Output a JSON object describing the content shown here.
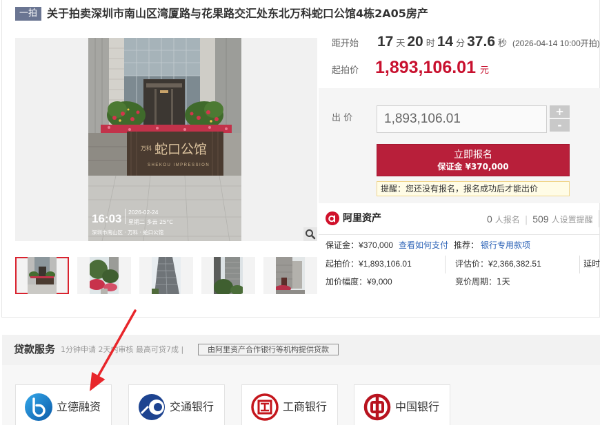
{
  "header": {
    "badge": "一拍",
    "title": "关于拍卖深圳市南山区湾厦路与花果路交汇处东北万科蛇口公馆4栋2A05房产"
  },
  "gallery": {
    "photo": {
      "sign_brand": "万科",
      "sign_name": "蛇口公馆",
      "sign_en": "SHEKOU IMPRESSION",
      "stamp_time": "16:03",
      "stamp_date": "2026-02-24",
      "stamp_weather": "星期二  多云 25°C",
      "stamp_location": "深圳市南山区 · 万科 · 蛇口公馆"
    },
    "zoom_icon": "magnifier-icon",
    "thumbnails": [
      {
        "selected": true
      },
      {
        "selected": false
      },
      {
        "selected": false
      },
      {
        "selected": false
      },
      {
        "selected": false
      }
    ]
  },
  "auction": {
    "countdown_label": "距开始",
    "countdown": {
      "days": "17",
      "days_unit": "天",
      "hours": "20",
      "hours_unit": "时",
      "minutes": "14",
      "minutes_unit": "分",
      "seconds": "37.6",
      "seconds_unit": "秒",
      "start_time_note": "(2026-04-14 10:00开拍)"
    },
    "start_price_label": "起拍价",
    "start_price": "1,893,106.01",
    "price_unit": "元",
    "bid": {
      "label": "出 价",
      "value": "1,893,106.01",
      "increment_label": "+",
      "decrement_label": "-"
    },
    "register_button": {
      "label": "立即报名",
      "deposit": "保证金 ¥370,000"
    },
    "notice": "提醒：您还没有报名，报名成功后才能出价"
  },
  "platform": {
    "logo_icon": "ali-asset-logo",
    "logo_text": "阿里资产",
    "signups": "0",
    "signups_label": "人报名",
    "separator": "|",
    "reminders": "509",
    "reminders_label": "人设置提醒"
  },
  "details": {
    "deposit_label": "保证金：",
    "deposit_value": "¥370,000",
    "payment_link": "查看如何支付",
    "recommend_label": "推荐：",
    "recommend_link": "银行专用款项",
    "start_price_label": "起拍价：",
    "start_price_value": "¥1,893,106.01",
    "appraisal_label": "评估价：",
    "appraisal_value": "¥2,366,382.51",
    "extension_label": "延时",
    "increment_label": "加价幅度：",
    "increment_value": "¥9,000",
    "cycle_label": "竞价周期：",
    "cycle_value": "1天"
  },
  "loan": {
    "title": "贷款服务",
    "subtitle": "1分钟申请 2天内审核 最高可贷7成 |",
    "provider_note": "由阿里资产合作银行等机构提供贷款",
    "partners": [
      {
        "name": "立德融资",
        "icon": "lide-finance-logo"
      },
      {
        "name": "交通银行",
        "icon": "bank-of-communications-logo"
      },
      {
        "name": "工商银行",
        "icon": "icbc-logo"
      },
      {
        "name": "中国银行",
        "icon": "bank-of-china-logo"
      }
    ]
  },
  "colors": {
    "accent_red": "#b81f3a",
    "price_red": "#c8102e",
    "link_blue": "#2f65b8",
    "badge": "#6a7592",
    "notice_bg": "#fffce6",
    "annotation_arrow": "#e8262b"
  }
}
